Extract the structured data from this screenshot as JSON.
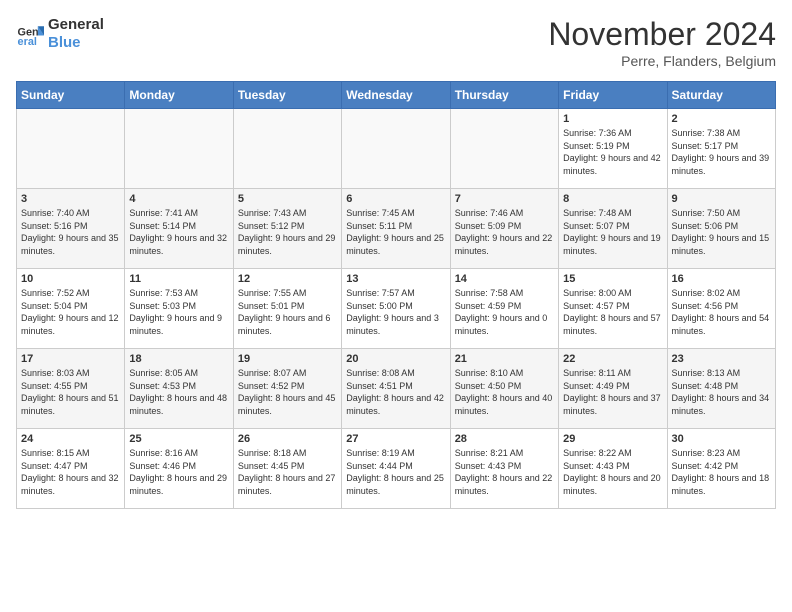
{
  "header": {
    "logo_line1": "General",
    "logo_line2": "Blue",
    "month": "November 2024",
    "location": "Perre, Flanders, Belgium"
  },
  "days_of_week": [
    "Sunday",
    "Monday",
    "Tuesday",
    "Wednesday",
    "Thursday",
    "Friday",
    "Saturday"
  ],
  "weeks": [
    [
      {
        "day": "",
        "info": ""
      },
      {
        "day": "",
        "info": ""
      },
      {
        "day": "",
        "info": ""
      },
      {
        "day": "",
        "info": ""
      },
      {
        "day": "",
        "info": ""
      },
      {
        "day": "1",
        "info": "Sunrise: 7:36 AM\nSunset: 5:19 PM\nDaylight: 9 hours and 42 minutes."
      },
      {
        "day": "2",
        "info": "Sunrise: 7:38 AM\nSunset: 5:17 PM\nDaylight: 9 hours and 39 minutes."
      }
    ],
    [
      {
        "day": "3",
        "info": "Sunrise: 7:40 AM\nSunset: 5:16 PM\nDaylight: 9 hours and 35 minutes."
      },
      {
        "day": "4",
        "info": "Sunrise: 7:41 AM\nSunset: 5:14 PM\nDaylight: 9 hours and 32 minutes."
      },
      {
        "day": "5",
        "info": "Sunrise: 7:43 AM\nSunset: 5:12 PM\nDaylight: 9 hours and 29 minutes."
      },
      {
        "day": "6",
        "info": "Sunrise: 7:45 AM\nSunset: 5:11 PM\nDaylight: 9 hours and 25 minutes."
      },
      {
        "day": "7",
        "info": "Sunrise: 7:46 AM\nSunset: 5:09 PM\nDaylight: 9 hours and 22 minutes."
      },
      {
        "day": "8",
        "info": "Sunrise: 7:48 AM\nSunset: 5:07 PM\nDaylight: 9 hours and 19 minutes."
      },
      {
        "day": "9",
        "info": "Sunrise: 7:50 AM\nSunset: 5:06 PM\nDaylight: 9 hours and 15 minutes."
      }
    ],
    [
      {
        "day": "10",
        "info": "Sunrise: 7:52 AM\nSunset: 5:04 PM\nDaylight: 9 hours and 12 minutes."
      },
      {
        "day": "11",
        "info": "Sunrise: 7:53 AM\nSunset: 5:03 PM\nDaylight: 9 hours and 9 minutes."
      },
      {
        "day": "12",
        "info": "Sunrise: 7:55 AM\nSunset: 5:01 PM\nDaylight: 9 hours and 6 minutes."
      },
      {
        "day": "13",
        "info": "Sunrise: 7:57 AM\nSunset: 5:00 PM\nDaylight: 9 hours and 3 minutes."
      },
      {
        "day": "14",
        "info": "Sunrise: 7:58 AM\nSunset: 4:59 PM\nDaylight: 9 hours and 0 minutes."
      },
      {
        "day": "15",
        "info": "Sunrise: 8:00 AM\nSunset: 4:57 PM\nDaylight: 8 hours and 57 minutes."
      },
      {
        "day": "16",
        "info": "Sunrise: 8:02 AM\nSunset: 4:56 PM\nDaylight: 8 hours and 54 minutes."
      }
    ],
    [
      {
        "day": "17",
        "info": "Sunrise: 8:03 AM\nSunset: 4:55 PM\nDaylight: 8 hours and 51 minutes."
      },
      {
        "day": "18",
        "info": "Sunrise: 8:05 AM\nSunset: 4:53 PM\nDaylight: 8 hours and 48 minutes."
      },
      {
        "day": "19",
        "info": "Sunrise: 8:07 AM\nSunset: 4:52 PM\nDaylight: 8 hours and 45 minutes."
      },
      {
        "day": "20",
        "info": "Sunrise: 8:08 AM\nSunset: 4:51 PM\nDaylight: 8 hours and 42 minutes."
      },
      {
        "day": "21",
        "info": "Sunrise: 8:10 AM\nSunset: 4:50 PM\nDaylight: 8 hours and 40 minutes."
      },
      {
        "day": "22",
        "info": "Sunrise: 8:11 AM\nSunset: 4:49 PM\nDaylight: 8 hours and 37 minutes."
      },
      {
        "day": "23",
        "info": "Sunrise: 8:13 AM\nSunset: 4:48 PM\nDaylight: 8 hours and 34 minutes."
      }
    ],
    [
      {
        "day": "24",
        "info": "Sunrise: 8:15 AM\nSunset: 4:47 PM\nDaylight: 8 hours and 32 minutes."
      },
      {
        "day": "25",
        "info": "Sunrise: 8:16 AM\nSunset: 4:46 PM\nDaylight: 8 hours and 29 minutes."
      },
      {
        "day": "26",
        "info": "Sunrise: 8:18 AM\nSunset: 4:45 PM\nDaylight: 8 hours and 27 minutes."
      },
      {
        "day": "27",
        "info": "Sunrise: 8:19 AM\nSunset: 4:44 PM\nDaylight: 8 hours and 25 minutes."
      },
      {
        "day": "28",
        "info": "Sunrise: 8:21 AM\nSunset: 4:43 PM\nDaylight: 8 hours and 22 minutes."
      },
      {
        "day": "29",
        "info": "Sunrise: 8:22 AM\nSunset: 4:43 PM\nDaylight: 8 hours and 20 minutes."
      },
      {
        "day": "30",
        "info": "Sunrise: 8:23 AM\nSunset: 4:42 PM\nDaylight: 8 hours and 18 minutes."
      }
    ]
  ]
}
